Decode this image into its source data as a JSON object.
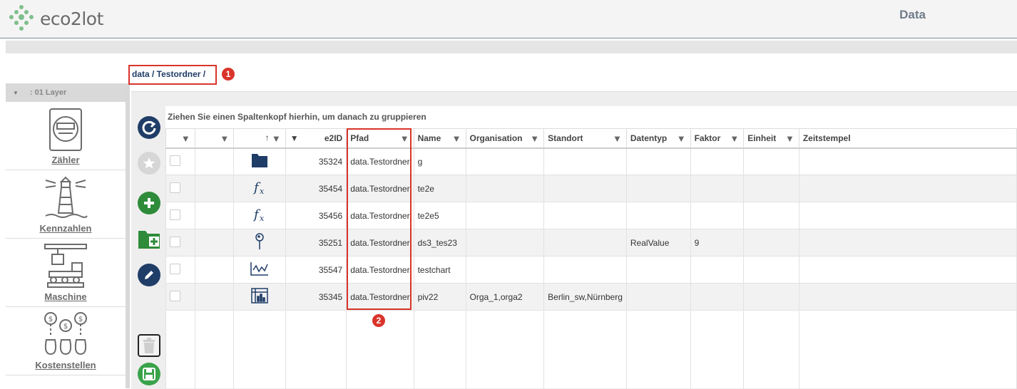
{
  "app": {
    "logo_text": "eco2lot",
    "page_title": "Data"
  },
  "breadcrumb": {
    "path": "data / Testordner /",
    "badge": "1"
  },
  "sidebar": {
    "layer_label": ": 01 Layer",
    "items": [
      {
        "label": "Zähler",
        "icon": "meter-icon"
      },
      {
        "label": "Kennzahlen",
        "icon": "lighthouse-icon"
      },
      {
        "label": "Maschine",
        "icon": "machine-icon"
      },
      {
        "label": "Kostenstellen",
        "icon": "money-bags-icon"
      }
    ]
  },
  "toolbar": [
    {
      "name": "refresh-button",
      "icon": "refresh-icon",
      "color": "#1f3d67"
    },
    {
      "name": "favorite-button",
      "icon": "star-icon",
      "color": "#cccccc"
    },
    {
      "name": "add-button",
      "icon": "plus-icon",
      "color": "#2e8b3a"
    },
    {
      "name": "add-folder-button",
      "icon": "folder-plus-icon",
      "color": "#2e8b3a"
    },
    {
      "name": "edit-button",
      "icon": "pencil-icon",
      "color": "#1f3d67"
    },
    {
      "name": "delete-button",
      "icon": "trash-icon",
      "color": "#cccccc"
    },
    {
      "name": "save-button",
      "icon": "save-icon",
      "color": "#3aa34a"
    }
  ],
  "grid": {
    "group_hint": "Ziehen Sie einen Spaltenkopf hierhin, um danach zu gruppieren",
    "sort_indicator": "↑",
    "columns": [
      "",
      "",
      "",
      "e2ID",
      "Pfad",
      "Name",
      "Organisation",
      "Standort",
      "Datentyp",
      "Faktor",
      "Einheit",
      "Zeitstempel"
    ],
    "rows": [
      {
        "icon": "folder-icon",
        "e2id": "35324",
        "pfad": "data.Testordner",
        "name": "g",
        "organisation": "",
        "standort": "",
        "datentyp": "",
        "faktor": ""
      },
      {
        "icon": "formula-icon",
        "e2id": "35454",
        "pfad": "data.Testordner",
        "name": "te2e",
        "organisation": "",
        "standort": "",
        "datentyp": "",
        "faktor": ""
      },
      {
        "icon": "formula-icon",
        "e2id": "35456",
        "pfad": "data.Testordner",
        "name": "te2e5",
        "organisation": "",
        "standort": "",
        "datentyp": "",
        "faktor": ""
      },
      {
        "icon": "datapoint-pin-icon",
        "e2id": "35251",
        "pfad": "data.Testordner",
        "name": "ds3_tes23",
        "organisation": "",
        "standort": "",
        "datentyp": "RealValue",
        "faktor": "9"
      },
      {
        "icon": "line-chart-icon",
        "e2id": "35547",
        "pfad": "data.Testordner",
        "name": "testchart",
        "organisation": "",
        "standort": "",
        "datentyp": "",
        "faktor": ""
      },
      {
        "icon": "pivot-table-icon",
        "e2id": "35345",
        "pfad": "data.Testordner",
        "name": "piv22",
        "organisation": "Orga_1,orga2",
        "standort": "Berlin_sw,Nürnberg",
        "datentyp": "",
        "faktor": ""
      }
    ],
    "pfad_badge": "2"
  },
  "colors": {
    "accent": "#1f3d67",
    "highlight": "#d9342b",
    "green": "#2e8b3a"
  }
}
